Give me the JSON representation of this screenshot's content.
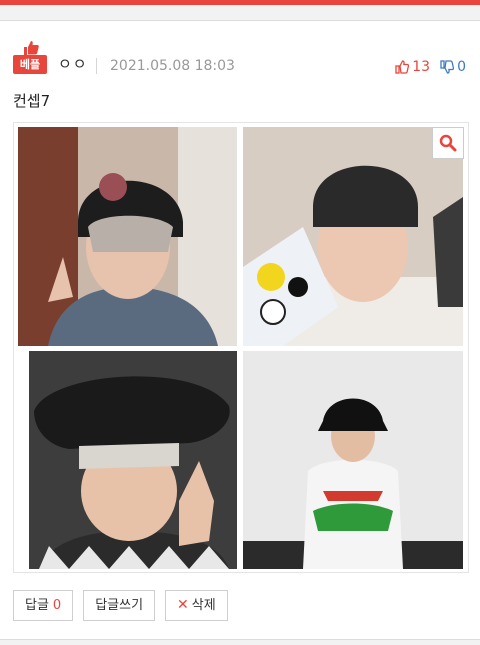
{
  "post": {
    "badge": "베플",
    "author": "ㅇㅇ",
    "date": "2021.05.08 18:03",
    "upvotes": "13",
    "downvotes": "0",
    "text": "컨셉7"
  },
  "actions": {
    "reply_label": "답글",
    "reply_count": "0",
    "write_reply_label": "답글쓰기",
    "delete_label": "삭제"
  },
  "colors": {
    "accent": "#e8453c",
    "down": "#3e7ac4"
  },
  "icons": [
    "thumb-up-icon",
    "thumb-down-icon",
    "magnifier-icon",
    "x-icon"
  ]
}
